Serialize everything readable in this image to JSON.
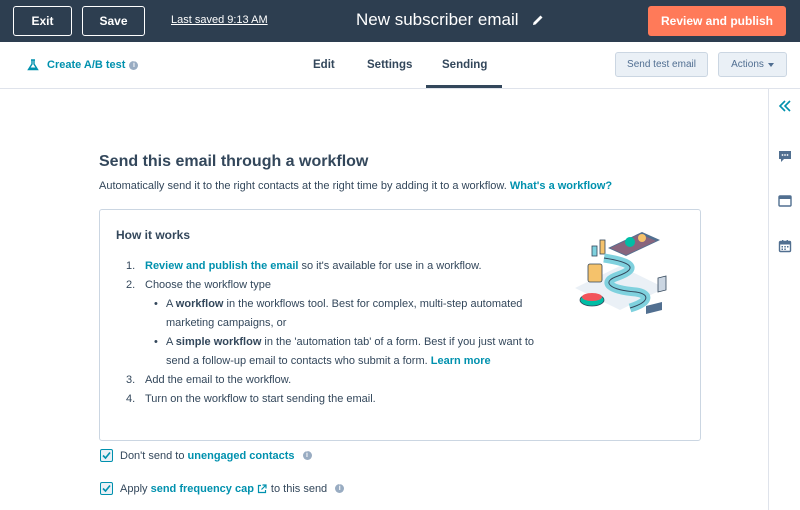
{
  "topbar": {
    "exit_label": "Exit",
    "save_label": "Save",
    "last_saved": "Last saved 9:13 AM",
    "title": "New subscriber email",
    "review_label": "Review and publish"
  },
  "subbar": {
    "ab_test_label": "Create A/B test",
    "tabs": [
      {
        "label": "Edit"
      },
      {
        "label": "Settings"
      },
      {
        "label": "Sending",
        "active": true
      }
    ],
    "send_test_label": "Send test email",
    "actions_label": "Actions"
  },
  "main": {
    "title": "Send this email through a workflow",
    "subtitle": "Automatically send it to the right contacts at the right time by adding it to a workflow.",
    "subtitle_link": "What's a workflow?",
    "how": {
      "title": "How it works",
      "step1_num": "1.",
      "step1_link": "Review and publish the email",
      "step1_rest": " so it's available for use in a workflow.",
      "step2_num": "2.",
      "step2_text": "Choose the workflow type",
      "bullet_glyph": "•",
      "b1_pre": "A ",
      "b1_bold": "workflow",
      "b1_rest": " in the workflows tool. Best for complex, multi-step automated marketing campaigns, or",
      "b2_pre": "A ",
      "b2_bold": "simple workflow",
      "b2_rest": " in the 'automation tab' of a form. Best if you just want to send a follow-up email to contacts who submit a form. ",
      "b2_link": "Learn more",
      "step3_num": "3.",
      "step3_text": "Add the email to the workflow.",
      "step4_num": "4.",
      "step4_text": "Turn on the workflow to start sending the email."
    },
    "checks": [
      {
        "pre": "Don't send to ",
        "link": "unengaged contacts",
        "post": "",
        "checked": true
      },
      {
        "pre": "Apply ",
        "link": "send frequency cap",
        "post": " to this send",
        "checked": true
      }
    ]
  },
  "colors": {
    "topbar": "#2d3e50",
    "accent": "#ff7a59",
    "link": "#0091ae",
    "text": "#33475b"
  }
}
